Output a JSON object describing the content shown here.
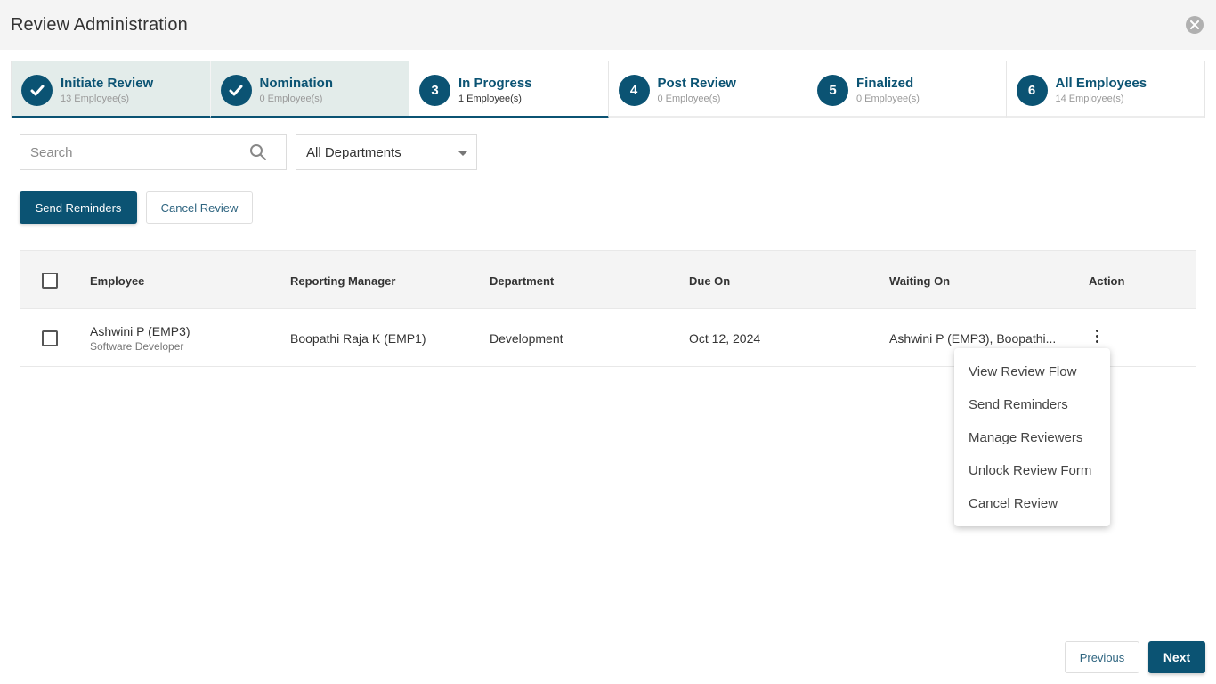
{
  "header": {
    "title": "Review Administration",
    "close_icon": "close-circle-icon"
  },
  "stepper": {
    "steps": [
      {
        "label": "Initiate Review",
        "count": "13 Employee(s)",
        "state": "done",
        "marker": "check"
      },
      {
        "label": "Nomination",
        "count": "0 Employee(s)",
        "state": "done",
        "marker": "check"
      },
      {
        "label": "In Progress",
        "count": "1 Employee(s)",
        "state": "active",
        "marker": "3"
      },
      {
        "label": "Post Review",
        "count": "0 Employee(s)",
        "state": "pending",
        "marker": "4"
      },
      {
        "label": "Finalized",
        "count": "0 Employee(s)",
        "state": "pending",
        "marker": "5"
      },
      {
        "label": "All Employees",
        "count": "14 Employee(s)",
        "state": "pending",
        "marker": "6"
      }
    ]
  },
  "filters": {
    "search_placeholder": "Search",
    "search_value": "",
    "department_selected": "All Departments"
  },
  "actions": {
    "send_reminders": "Send Reminders",
    "cancel_review": "Cancel Review"
  },
  "table": {
    "columns": [
      "Employee",
      "Reporting Manager",
      "Department",
      "Due On",
      "Waiting On",
      "Action"
    ],
    "rows": [
      {
        "employee_name": "Ashwini P (EMP3)",
        "employee_role": "Software Developer",
        "reporting_manager": "Boopathi Raja K (EMP1)",
        "department": "Development",
        "due_on": "Oct 12, 2024",
        "waiting_on": "Ashwini P (EMP3), Boopathi..."
      }
    ]
  },
  "action_menu": {
    "items": [
      "View Review Flow",
      "Send Reminders",
      "Manage Reviewers",
      "Unlock Review Form",
      "Cancel Review"
    ]
  },
  "footer": {
    "previous": "Previous",
    "next": "Next"
  },
  "colors": {
    "primary": "#0b5373",
    "done_tab_bg": "#e3ecea",
    "header_bg": "#f4f4f4"
  }
}
